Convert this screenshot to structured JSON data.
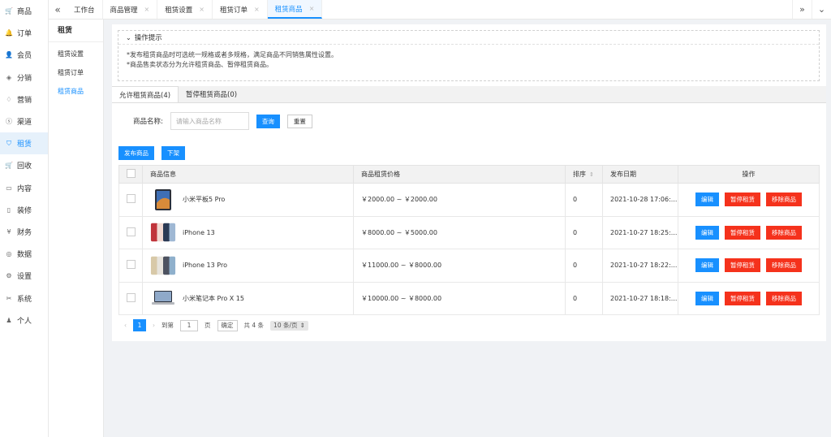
{
  "sidebar": {
    "items": [
      {
        "label": "商品",
        "icon": "cart-icon",
        "glyph": "🛒"
      },
      {
        "label": "订单",
        "icon": "bell-icon",
        "glyph": "🔔"
      },
      {
        "label": "会员",
        "icon": "user-icon",
        "glyph": "👤"
      },
      {
        "label": "分销",
        "icon": "layers-icon",
        "glyph": "◈"
      },
      {
        "label": "营销",
        "icon": "diamond-icon",
        "glyph": "♢"
      },
      {
        "label": "渠道",
        "icon": "coin-icon",
        "glyph": "ⓢ"
      },
      {
        "label": "租赁",
        "icon": "shield-icon",
        "glyph": "⛉"
      },
      {
        "label": "回收",
        "icon": "cart-icon",
        "glyph": "🛒"
      },
      {
        "label": "内容",
        "icon": "book-icon",
        "glyph": "▭"
      },
      {
        "label": "装修",
        "icon": "phone-icon",
        "glyph": "▯"
      },
      {
        "label": "财务",
        "icon": "yen-icon",
        "glyph": "¥"
      },
      {
        "label": "数据",
        "icon": "globe-icon",
        "glyph": "◎"
      },
      {
        "label": "设置",
        "icon": "gear-icon",
        "glyph": "⚙"
      },
      {
        "label": "系统",
        "icon": "tools-icon",
        "glyph": "✂"
      },
      {
        "label": "个人",
        "icon": "person-icon",
        "glyph": "♟"
      }
    ],
    "active_index": 6
  },
  "tabs": {
    "items": [
      {
        "label": "工作台",
        "closable": false
      },
      {
        "label": "商品管理",
        "closable": true
      },
      {
        "label": "租赁设置",
        "closable": true
      },
      {
        "label": "租赁订单",
        "closable": true
      },
      {
        "label": "租赁商品",
        "closable": true
      }
    ],
    "close_glyph": "×"
  },
  "subsidebar": {
    "title": "租赁",
    "items": [
      "租赁设置",
      "租赁订单",
      "租赁商品"
    ]
  },
  "tips": {
    "title": "操作提示",
    "lines": [
      "*发布租赁商品时可选统一规格或者多规格，满足商品不同销售属性设置。",
      "*商品售卖状态分为允许租赁商品、暂停租赁商品。"
    ]
  },
  "content_tabs": [
    "允许租赁商品(4)",
    "暂停租赁商品(0)"
  ],
  "search": {
    "label": "商品名称:",
    "placeholder": "请输入商品名称",
    "query_label": "查询",
    "reset_label": "重置"
  },
  "actions": {
    "publish_label": "发布商品",
    "offline_label": "下架"
  },
  "table": {
    "columns": [
      "商品信息",
      "商品租赁价格",
      "排序",
      "发布日期",
      "操作"
    ],
    "rows": [
      {
        "name": "小米平板5 Pro",
        "price": "￥2000.00 ~ ￥2000.00",
        "sort": "0",
        "date": "2021-10-28 17:06:...",
        "thumb": "tablet"
      },
      {
        "name": "iPhone 13",
        "price": "￥8000.00 ~ ￥5000.00",
        "sort": "0",
        "date": "2021-10-27 18:25:...",
        "thumb": "phones"
      },
      {
        "name": "iPhone 13 Pro",
        "price": "￥11000.00 ~ ￥8000.00",
        "sort": "0",
        "date": "2021-10-27 18:22:...",
        "thumb": "phones-pro"
      },
      {
        "name": "小米笔记本 Pro X 15",
        "price": "￥10000.00 ~ ￥8000.00",
        "sort": "0",
        "date": "2021-10-27 18:18:...",
        "thumb": "laptop"
      }
    ],
    "op_labels": {
      "edit": "编辑",
      "pause": "暂停租赁",
      "remove": "移除商品"
    }
  },
  "pager": {
    "current": "1",
    "goto_label": "到第",
    "goto_value": "1",
    "page_suffix": "页",
    "confirm_label": "确定",
    "total": "共 4 条",
    "page_size": "10 条/页"
  },
  "colors": {
    "accent": "#1890ff",
    "danger": "#f5321c"
  }
}
